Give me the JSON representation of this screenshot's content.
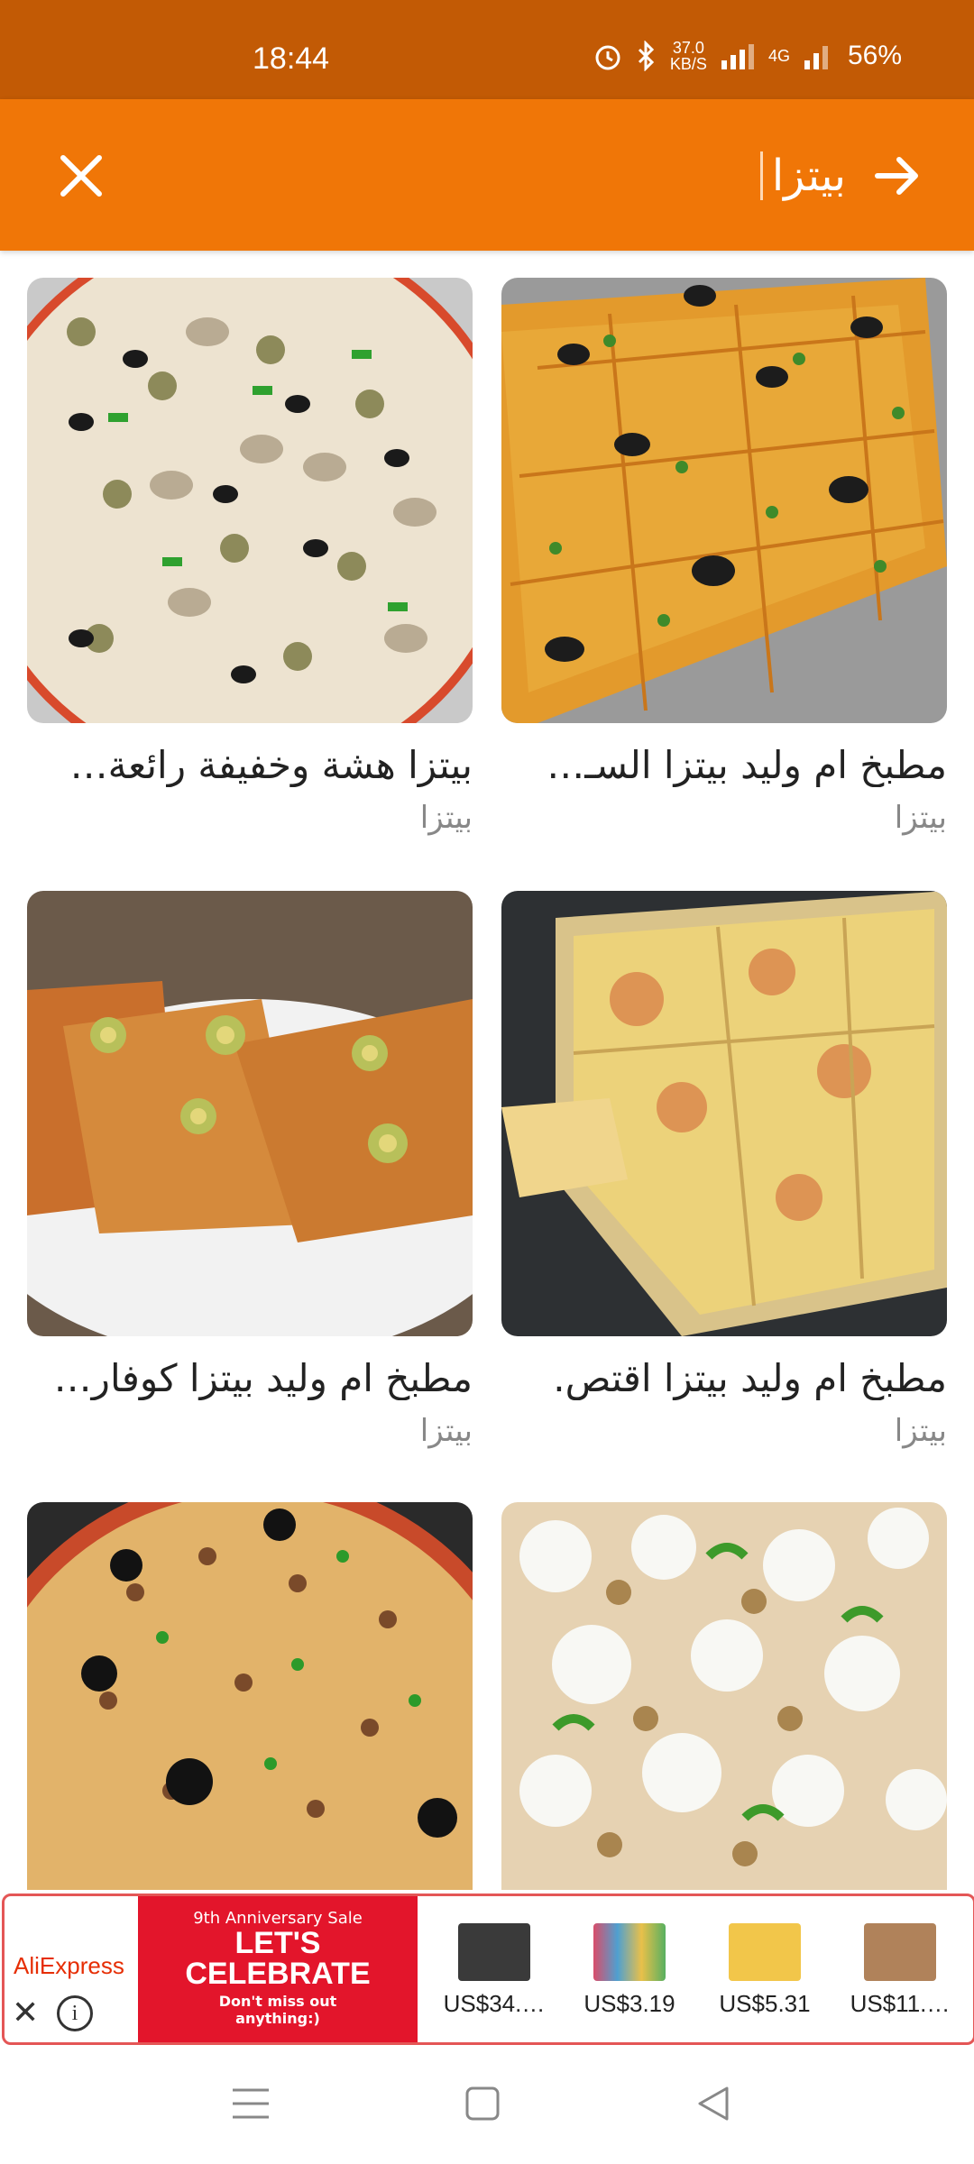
{
  "status_bar": {
    "time": "18:44",
    "net_speed_value": "37.0",
    "net_speed_unit": "KB/S",
    "network_type": "4G",
    "battery": "56%"
  },
  "header": {
    "search_value": "بيتزا",
    "close_icon": "close-icon",
    "submit_icon": "arrow-right-icon"
  },
  "results": [
    {
      "title": "مطبخ ام وليد بيتزا السـ…",
      "category": "بيتزا",
      "image": "square-pizza-olives"
    },
    {
      "title": "بيتزا هشة وخفيفة رائعة…",
      "category": "بيتزا",
      "image": "pizza-mushrooms-olives"
    },
    {
      "title": "مطبخ ام وليد بيتزا اقتص.",
      "category": "بيتزا",
      "image": "sheet-pizza-cheese"
    },
    {
      "title": "مطبخ ام وليد بيتزا كوفار…",
      "category": "بيتزا",
      "image": "stuffed-pizza-rolls"
    },
    {
      "title": "",
      "category": "",
      "image": "white-cheese-pizza"
    },
    {
      "title": "",
      "category": "",
      "image": "meat-pizza-olives"
    }
  ],
  "ad": {
    "brand": "AliExpress",
    "banner_line1": "9th Anniversary Sale",
    "banner_line2a": "LET'S",
    "banner_line2b": "CELEBRATE",
    "banner_line3a": "Don't miss out",
    "banner_line3b": "anything:)",
    "products": [
      {
        "price": "US$34.…"
      },
      {
        "price": "US$3.19"
      },
      {
        "price": "US$5.31"
      },
      {
        "price": "US$11.…"
      }
    ]
  },
  "colors": {
    "status_bar": "#c25a05",
    "header": "#f07607",
    "ad_border": "#e45656"
  }
}
